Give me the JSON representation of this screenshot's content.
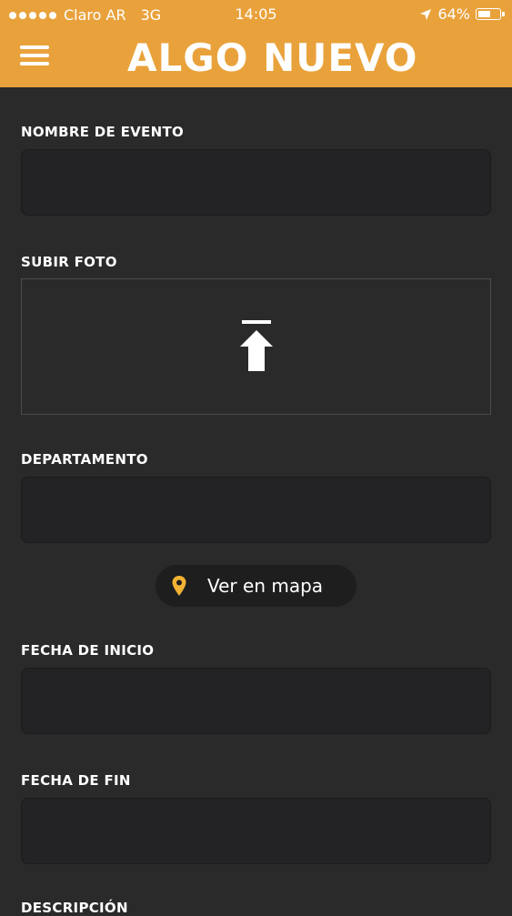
{
  "status_bar": {
    "carrier": "Claro AR",
    "network": "3G",
    "time": "14:05",
    "battery": "64%",
    "battery_level": 0.64
  },
  "header": {
    "logo_text": "ALGO NUEVO",
    "menu_icon": "hamburger-menu-icon",
    "background_color": "#e9a23b"
  },
  "form": {
    "event_name_label": "NOMBRE DE EVENTO",
    "event_name_value": "",
    "photo_label": "SUBIR FOTO",
    "upload_icon": "upload-icon",
    "department_label": "DEPARTAMENTO",
    "department_value": "",
    "map_button_label": "Ver en mapa",
    "map_icon": "map-pin-icon",
    "start_date_label": "FECHA DE INICIO",
    "start_date_value": "",
    "end_date_label": "FECHA DE FIN",
    "end_date_value": "",
    "description_label": "DESCRIPCIÓN"
  },
  "colors": {
    "background": "#2a2a2b",
    "field": "#232325",
    "accent": "#e9a23b",
    "pin": "#f2b233"
  }
}
